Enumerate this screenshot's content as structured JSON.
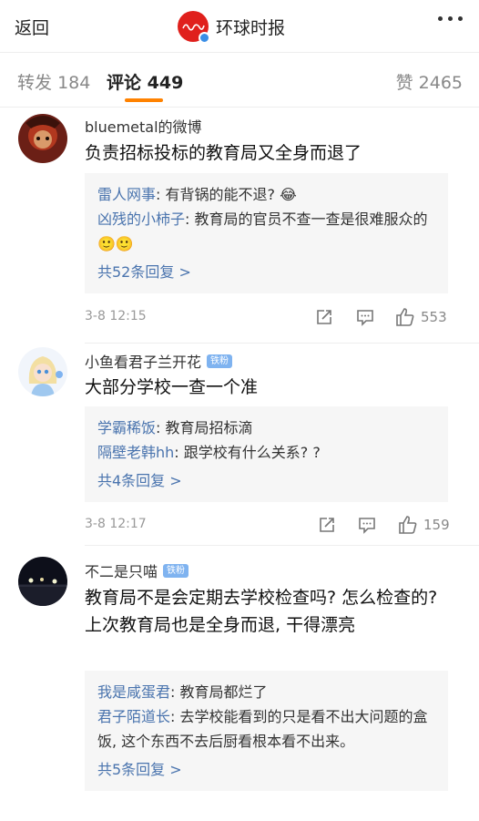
{
  "header": {
    "back_label": "返回",
    "title": "环球时报",
    "logo_color": "#e0201c"
  },
  "tabs": {
    "repost_label": "转发",
    "repost_count": "184",
    "comment_label": "评论",
    "comment_count": "449",
    "like_label": "赞",
    "like_count": "2465",
    "accent": "#ff8200"
  },
  "comments": [
    {
      "user": "bluemetal的微博",
      "badge": "",
      "text": "负责招标投标的教育局又全身而退了",
      "replies": [
        {
          "name": "雷人网事",
          "text": ": 有背锅的能不退? 😂"
        },
        {
          "name": "凶残的小柿子",
          "text": ": 教育局的官员不查一查是很难服众的🙂🙂"
        }
      ],
      "more_replies": "共52条回复 >",
      "time": "3-8 12:15",
      "likes": "553"
    },
    {
      "user": "小鱼看君子兰开花",
      "badge": "铁粉",
      "text": "大部分学校一查一个准",
      "replies": [
        {
          "name": "学霸稀饭",
          "text": ": 教育局招标滴"
        },
        {
          "name": "隔壁老韩hh",
          "text": ": 跟学校有什么关系? ?"
        }
      ],
      "more_replies": "共4条回复 >",
      "time": "3-8 12:17",
      "likes": "159"
    },
    {
      "user": "不二是只喵",
      "badge": "铁粉",
      "text": "教育局不是会定期去学校检查吗? 怎么检查的? 上次教育局也是全身而退, 干得漂亮",
      "replies": [
        {
          "name": "我是咸蛋君",
          "text": ": 教育局都烂了"
        },
        {
          "name": "君子陌道长",
          "text": ": 去学校能看到的只是看不出大问题的盒饭, 这个东西不去后厨看根本看不出来。"
        }
      ],
      "more_replies": "共5条回复 >"
    }
  ]
}
